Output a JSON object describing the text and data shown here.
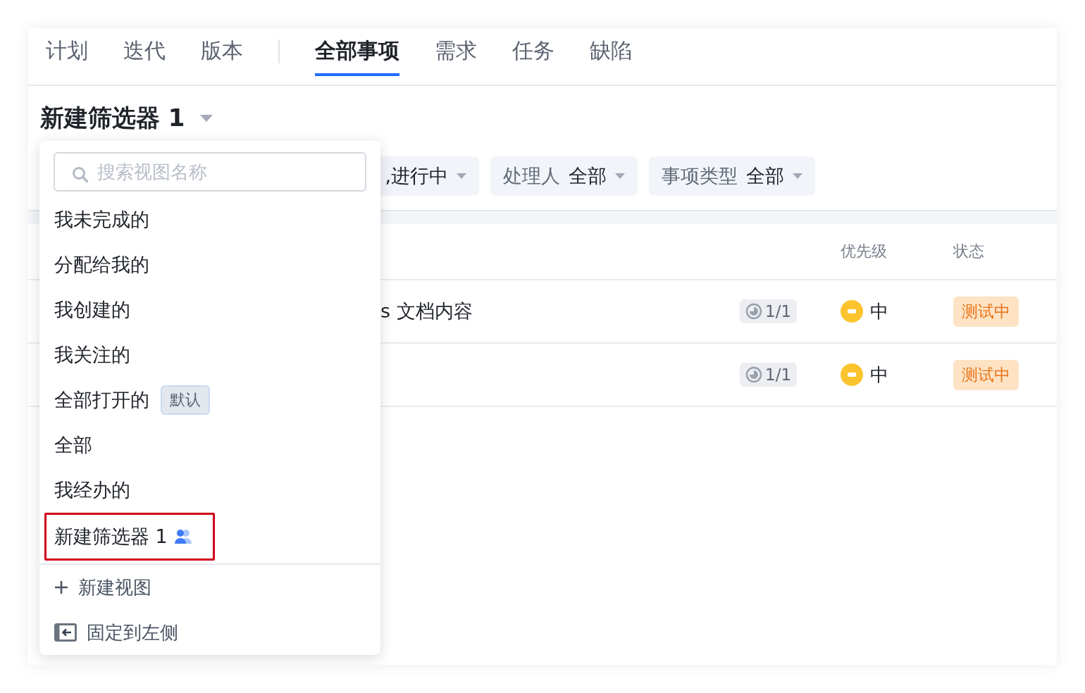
{
  "tab_groups": [
    [
      {
        "label": "计划",
        "selected": false
      },
      {
        "label": "迭代",
        "selected": false
      },
      {
        "label": "版本",
        "selected": false
      }
    ],
    [
      {
        "label": "全部事项",
        "selected": true
      },
      {
        "label": "需求",
        "selected": false
      },
      {
        "label": "任务",
        "selected": false
      },
      {
        "label": "缺陷",
        "selected": false
      }
    ]
  ],
  "view_title": "新建筛选器 1",
  "filters": [
    {
      "value": ",进行中"
    },
    {
      "label": "处理人",
      "value": "全部"
    },
    {
      "label": "事项类型",
      "value": "全部"
    }
  ],
  "table": {
    "columns": [
      "优先级",
      "状态"
    ],
    "rows": [
      {
        "title": "s 文档内容",
        "progress": "1/1",
        "priority": "中",
        "status": "测试中"
      },
      {
        "progress": "1/1",
        "priority": "中",
        "status": "测试中"
      }
    ]
  },
  "view_menu": {
    "search": {
      "placeholder": "搜索视图名称"
    },
    "items": [
      {
        "label": "我未完成的",
        "highlighted": false
      },
      {
        "label": "分配给我的",
        "highlighted": false
      },
      {
        "label": "我创建的",
        "highlighted": false
      },
      {
        "label": "我关注的",
        "highlighted": false
      },
      {
        "label": "全部打开的",
        "badge": "默认",
        "highlighted": false
      },
      {
        "label": "全部",
        "highlighted": false
      },
      {
        "label": "我经办的",
        "highlighted": false
      },
      {
        "label": "新建筛选器 1",
        "shared": true,
        "highlighted": true
      }
    ],
    "actions": [
      {
        "kind": "add",
        "label": "新建视图"
      },
      {
        "kind": "pin",
        "label": "固定到左侧"
      }
    ]
  }
}
